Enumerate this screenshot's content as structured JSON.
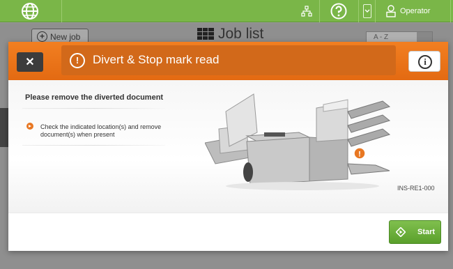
{
  "topbar": {
    "user_label": "Operator"
  },
  "background": {
    "new_job_label": "New job",
    "title": "Job list",
    "sort_value": "A - Z"
  },
  "dialog": {
    "close_label": "✕",
    "title": "Divert & Stop mark read",
    "message": "Please remove the diverted document",
    "step": "Check the indicated location(s) and remove document(s) when present",
    "image_code": "INS-RE1-000",
    "start_label": "Start"
  },
  "colors": {
    "topbar": "#7ab648",
    "header_orange": "#f27f21",
    "title_orange": "#d2691a",
    "start_green": "#6ab13a"
  }
}
